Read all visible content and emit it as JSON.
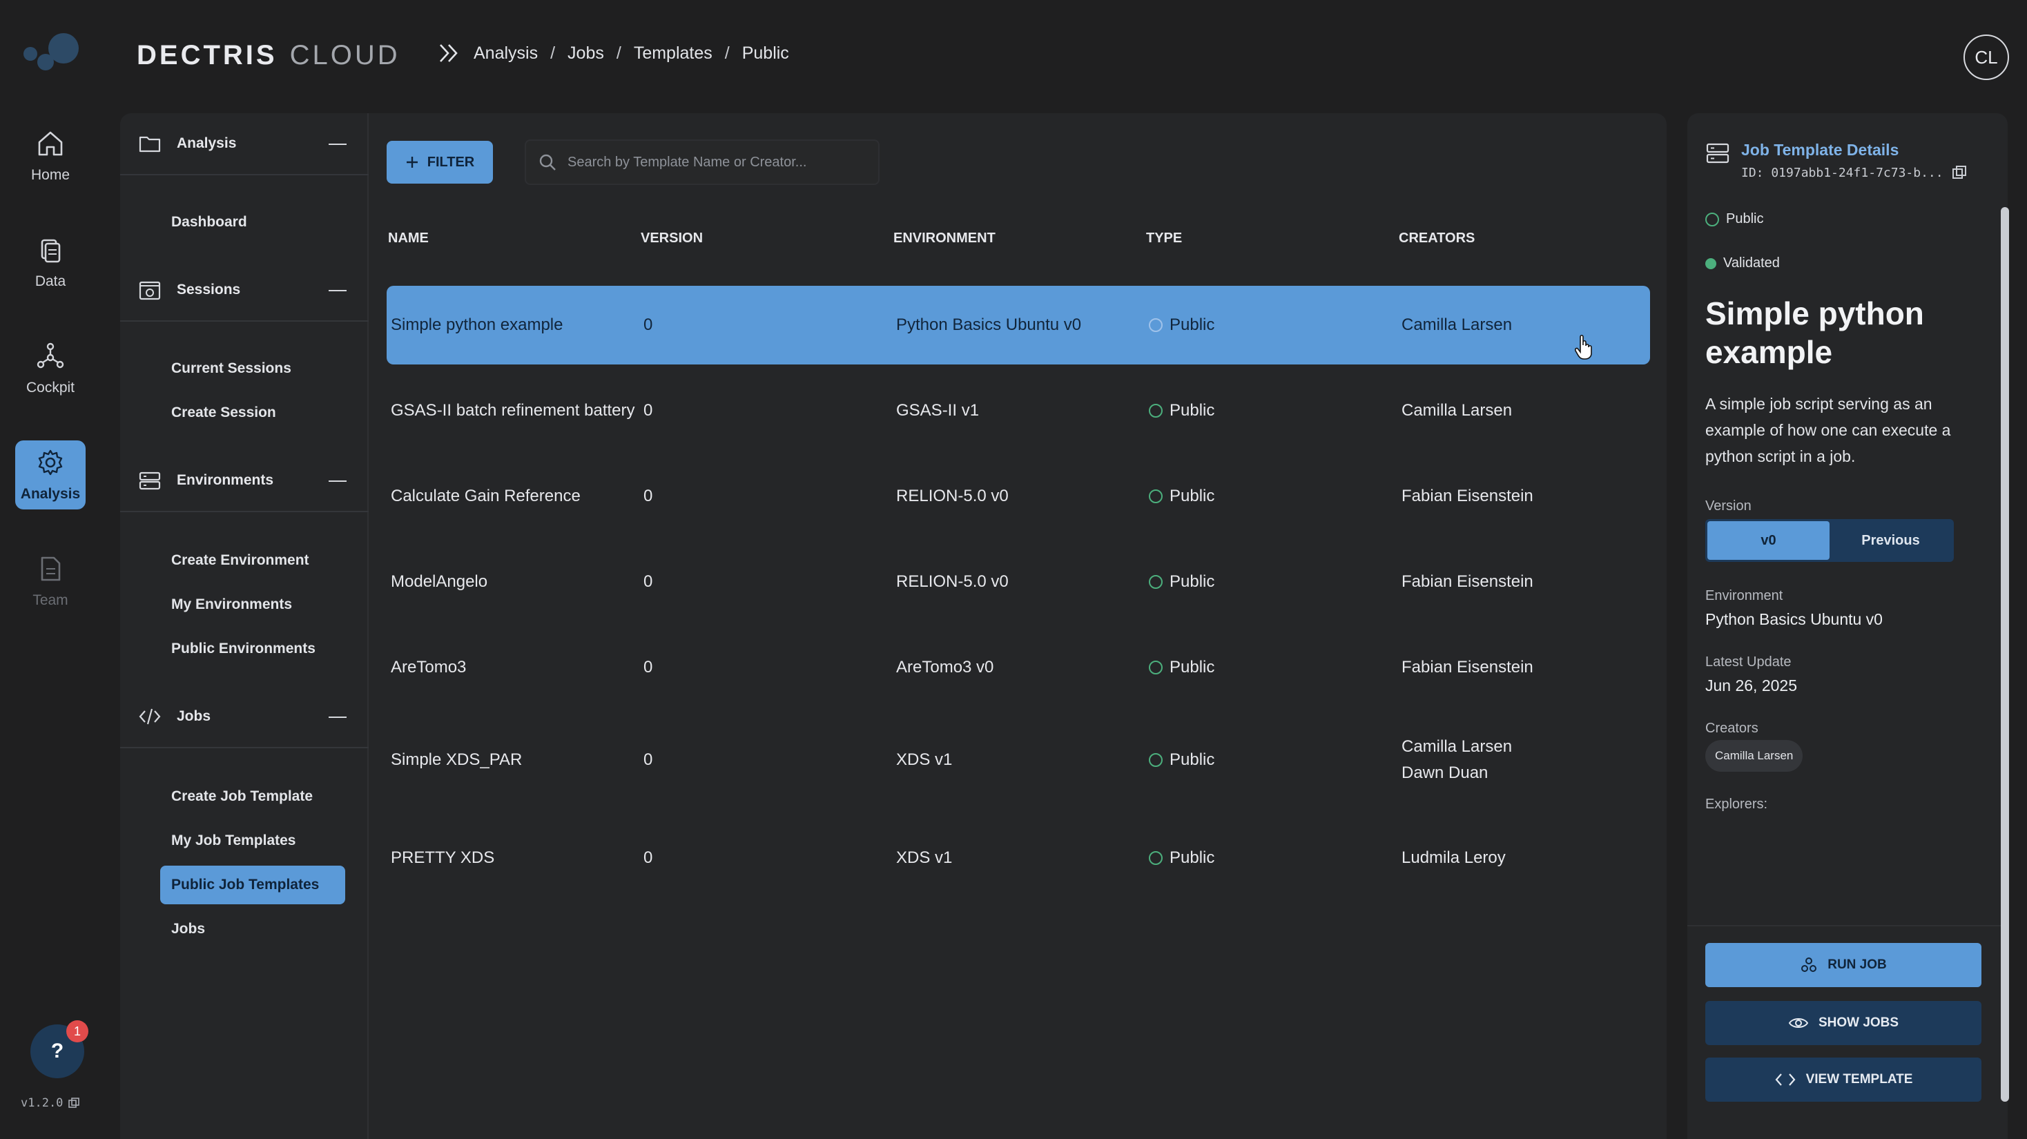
{
  "brand": {
    "part1": "DECTRIS",
    "part2": "CLOUD"
  },
  "breadcrumb": [
    "Analysis",
    "Jobs",
    "Templates",
    "Public"
  ],
  "breadcrumb_sep": "/",
  "avatar": "CL",
  "rail": {
    "items": [
      {
        "label": "Home",
        "icon": "home-icon"
      },
      {
        "label": "Data",
        "icon": "data-icon"
      },
      {
        "label": "Cockpit",
        "icon": "cockpit-icon"
      },
      {
        "label": "Analysis",
        "icon": "gear-icon",
        "active": true
      },
      {
        "label": "Team",
        "icon": "document-icon",
        "disabled": true
      }
    ],
    "help": "?",
    "help_badge": "1",
    "version": "v1.2.0"
  },
  "subnav": {
    "groups": [
      {
        "title": "Analysis",
        "icon": "folder-icon",
        "links": [
          "Dashboard"
        ]
      },
      {
        "title": "Sessions",
        "icon": "session-icon",
        "links": [
          "Current Sessions",
          "Create Session"
        ]
      },
      {
        "title": "Environments",
        "icon": "server-icon",
        "links": [
          "Create Environment",
          "My Environments",
          "Public Environments"
        ]
      },
      {
        "title": "Jobs",
        "icon": "code-icon",
        "links": [
          "Create Job Template",
          "My Job Templates",
          "Public Job Templates",
          "Jobs"
        ],
        "active": "Public Job Templates"
      }
    ]
  },
  "toolbar": {
    "filter_label": "FILTER",
    "search_placeholder": "Search by Template Name or Creator..."
  },
  "table": {
    "columns": [
      "NAME",
      "VERSION",
      "ENVIRONMENT",
      "TYPE",
      "CREATORS"
    ],
    "rows": [
      {
        "name": "Simple python example",
        "version": "0",
        "environment": "Python Basics Ubuntu v0",
        "type": "Public",
        "creators": [
          "Camilla Larsen"
        ],
        "selected": true
      },
      {
        "name": "GSAS-II batch refinement battery",
        "version": "0",
        "environment": "GSAS-II v1",
        "type": "Public",
        "creators": [
          "Camilla Larsen"
        ]
      },
      {
        "name": "Calculate Gain Reference",
        "version": "0",
        "environment": "RELION-5.0 v0",
        "type": "Public",
        "creators": [
          "Fabian Eisenstein"
        ]
      },
      {
        "name": "ModelAngelo",
        "version": "0",
        "environment": "RELION-5.0 v0",
        "type": "Public",
        "creators": [
          "Fabian Eisenstein"
        ]
      },
      {
        "name": "AreTomo3",
        "version": "0",
        "environment": "AreTomo3 v0",
        "type": "Public",
        "creators": [
          "Fabian Eisenstein"
        ]
      },
      {
        "name": "Simple XDS_PAR",
        "version": "0",
        "environment": "XDS v1",
        "type": "Public",
        "creators": [
          "Camilla Larsen",
          "Dawn Duan"
        ]
      },
      {
        "name": "PRETTY XDS",
        "version": "0",
        "environment": "XDS v1",
        "type": "Public",
        "creators": [
          "Ludmila Leroy"
        ]
      }
    ]
  },
  "details": {
    "title": "Job Template Details",
    "id": "ID: 0197abb1-24f1-7c73-b...",
    "visibility": "Public",
    "status": "Validated",
    "name": "Simple python example",
    "description": "A simple job script serving as an example of how one can execute a python script in a job.",
    "version_label": "Version",
    "version_current": "v0",
    "version_previous": "Previous",
    "environment_label": "Environment",
    "environment": "Python Basics Ubuntu v0",
    "latest_update_label": "Latest Update",
    "latest_update": "Jun 26, 2025",
    "creators_label": "Creators",
    "creators": [
      "Camilla Larsen"
    ],
    "explorers_label": "Explorers:",
    "run_job": "RUN JOB",
    "show_jobs": "SHOW JOBS",
    "view_template": "VIEW TEMPLATE"
  },
  "colors": {
    "accent": "#5b9ad8",
    "accent_dark": "#1d3a5a",
    "background": "#1f1f20",
    "panel": "#252628",
    "success": "#4caf7d",
    "badge": "#e14b4b"
  }
}
